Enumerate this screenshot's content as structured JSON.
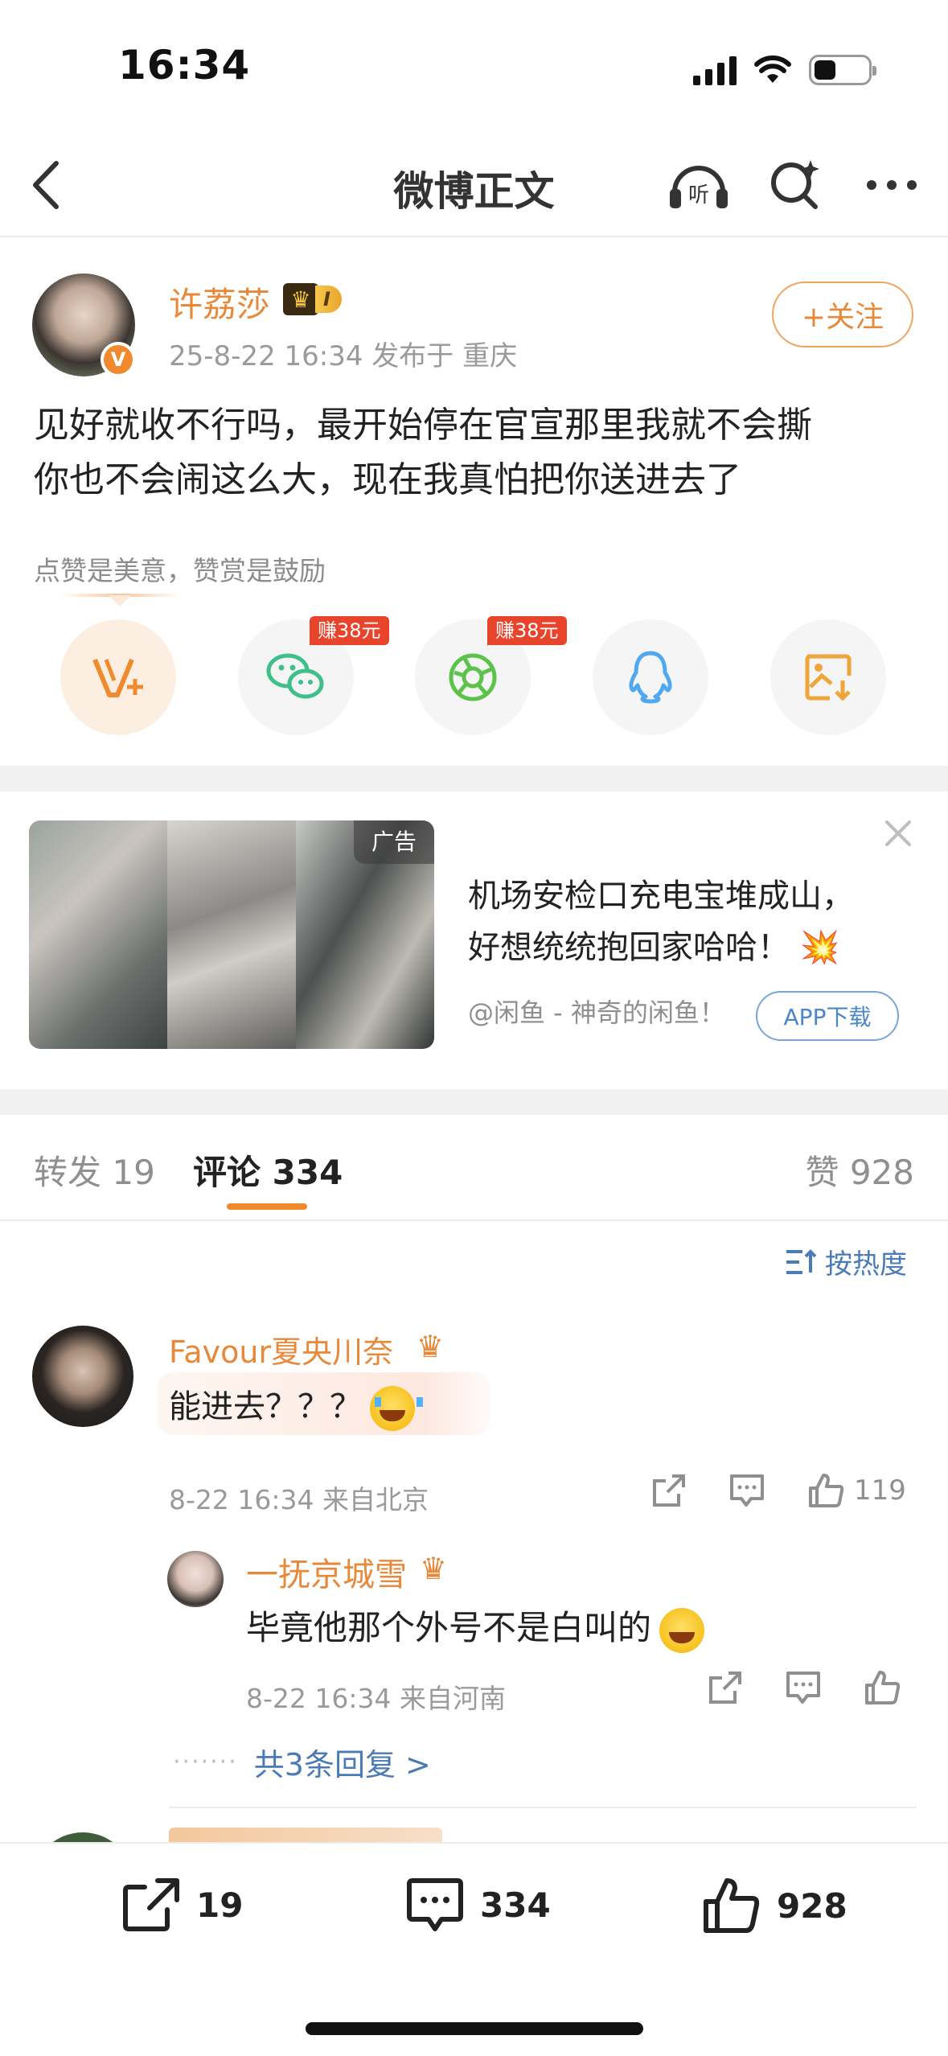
{
  "status_bar": {
    "time": "16:34"
  },
  "navbar": {
    "title": "微博正文",
    "listen_label": "听"
  },
  "post": {
    "author": "许荔莎",
    "level_badge": "I",
    "verified_badge": "V",
    "follow_label": "+关注",
    "meta": "25-8-22 16:34  发布于 重庆",
    "text_line1": "见好就收不行吗，最开始停在官宣那里我就不会撕",
    "text_line2": "你也不会闹这么大，现在我真怕把你送进去了",
    "reward_hint": "点赞是美意，赞赏是鼓励"
  },
  "share": {
    "items": [
      {
        "icon": "reward-v-icon"
      },
      {
        "icon": "wechat-icon",
        "tag": "赚38元"
      },
      {
        "icon": "moments-icon",
        "tag": "赚38元"
      },
      {
        "icon": "qq-icon"
      },
      {
        "icon": "save-image-icon"
      }
    ]
  },
  "ad": {
    "tag": "广告",
    "title_line1": "机场安检口充电宝堆成山，",
    "title_line2": "好想统统抱回家哈哈！",
    "source": "@闲鱼 - 神奇的闲鱼！",
    "download_label": "APP下载"
  },
  "tabs": {
    "repost": "转发 19",
    "comments": "评论 334",
    "likes": "赞 928"
  },
  "sort_label": "按热度",
  "comment": {
    "author": "Favour夏央川奈",
    "text": "能进去？？？",
    "meta": "8-22 16:34  来自北京",
    "like_count": "119",
    "reply": {
      "author": "一抚京城雪",
      "text": "毕竟他那个外号不是白叫的",
      "meta": "8-22 16:34  来自河南"
    },
    "more_replies": "共3条回复 >"
  },
  "bottom_bar": {
    "repost_count": "19",
    "comment_count": "334",
    "like_count": "928"
  },
  "colors": {
    "accent": "#e8893a",
    "link": "#4a7bb7",
    "tag_red": "#e8442c"
  }
}
